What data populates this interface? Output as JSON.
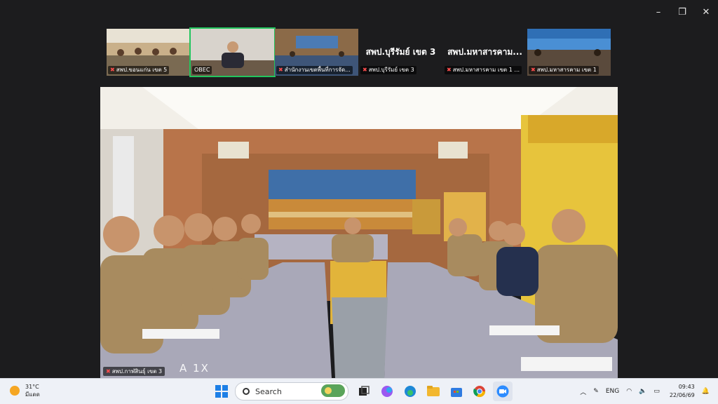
{
  "window_controls": {
    "minimize": "–",
    "maximize": "❐",
    "close": "✕"
  },
  "tiles": [
    {
      "label": "สพป.ขอนแก่น เขต 5",
      "big_text": ""
    },
    {
      "label": "OBEC",
      "big_text": ""
    },
    {
      "label": "สำนักงานเขตพื้นที่การจัด...",
      "big_text": ""
    },
    {
      "label": "สพป.บุรีรัมย์ เขต 3",
      "big_text": "สพป.บุรีรัมย์ เขต 3"
    },
    {
      "label": "สพป.มหาสารคาม เขต 1 ...",
      "big_text": "สพป.มหาสารคาม..."
    },
    {
      "label": "สพป.มหาสารคาม เขต 1",
      "big_text": ""
    }
  ],
  "main_video": {
    "label": "สพป.กาฬสินธุ์ เขต 3",
    "watermark": "A 1X"
  },
  "taskbar": {
    "weather_temp": "31°C",
    "weather_desc": "มีแดด",
    "search_placeholder": "Search",
    "lang": "ENG",
    "time": "09:43",
    "date": "22/06/69"
  }
}
